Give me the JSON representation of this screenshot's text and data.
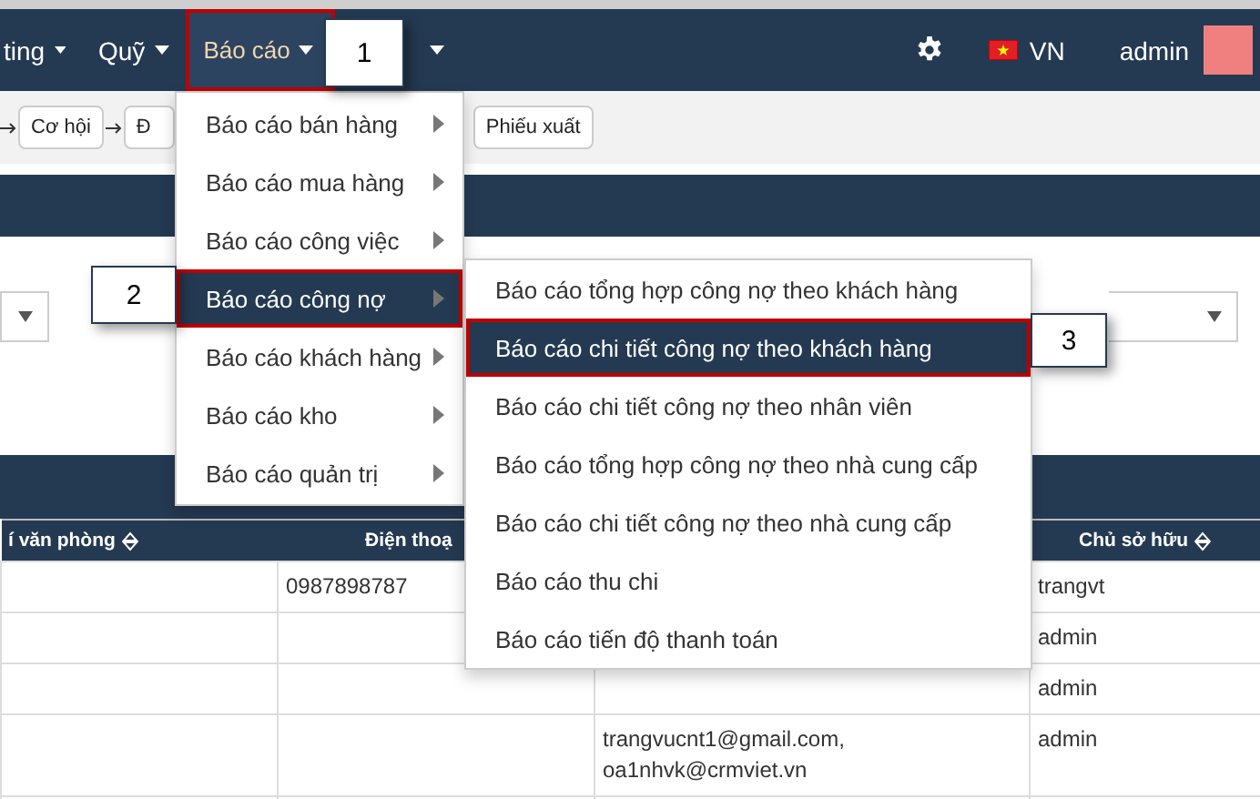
{
  "navbar": {
    "items": [
      {
        "label": "ting",
        "selected": false
      },
      {
        "label": "Quỹ",
        "selected": false
      },
      {
        "label": "Báo cáo",
        "selected": true
      }
    ],
    "language": "VN",
    "user": "admin"
  },
  "breadcrumb": [
    "Cơ hội",
    "Đ",
    "Phiếu xuất"
  ],
  "table": {
    "columns": [
      "í văn phòng",
      "Điện thoạ",
      "",
      "Chủ sở hữu"
    ],
    "rows": [
      {
        "cells": [
          "",
          "0987898787",
          "",
          "trangvt"
        ]
      },
      {
        "cells": [
          "",
          "",
          "",
          "admin"
        ]
      },
      {
        "cells": [
          "",
          "",
          "",
          "admin"
        ]
      },
      {
        "cells": [
          "",
          "",
          "trangvucnt1@gmail.com,\noa1nhvk@crmviet.vn",
          "admin"
        ]
      }
    ]
  },
  "menu": {
    "items": [
      {
        "label": "Báo cáo bán hàng",
        "selected": false
      },
      {
        "label": "Báo cáo mua hàng",
        "selected": false
      },
      {
        "label": "Báo cáo công việc",
        "selected": false
      },
      {
        "label": "Báo cáo công nợ",
        "selected": true
      },
      {
        "label": "Báo cáo khách hàng",
        "selected": false
      },
      {
        "label": "Báo cáo kho",
        "selected": false
      },
      {
        "label": "Báo cáo quản trị",
        "selected": false
      }
    ]
  },
  "submenu": {
    "items": [
      {
        "label": "Báo cáo tổng hợp công nợ theo khách hàng",
        "selected": false
      },
      {
        "label": "Báo cáo chi tiết công nợ theo khách hàng",
        "selected": true
      },
      {
        "label": "Báo cáo chi tiết công nợ theo nhân viên",
        "selected": false
      },
      {
        "label": "Báo cáo tổng hợp công nợ theo nhà cung cấp",
        "selected": false
      },
      {
        "label": "Báo cáo chi tiết công nợ theo nhà cung cấp",
        "selected": false
      },
      {
        "label": "Báo cáo thu chi",
        "selected": false
      },
      {
        "label": "Báo cáo tiến độ thanh toán",
        "selected": false
      }
    ]
  },
  "callouts": [
    "1",
    "2",
    "3"
  ]
}
